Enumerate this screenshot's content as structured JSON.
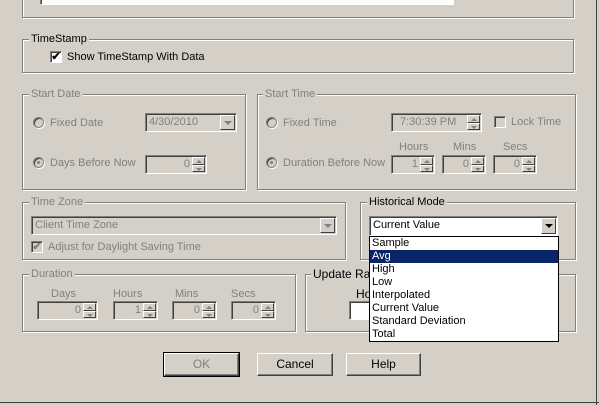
{
  "top_field": {},
  "timestamp": {
    "legend": "TimeStamp",
    "show_label": "Show TimeStamp With Data",
    "checked": true
  },
  "start_date": {
    "legend": "Start Date",
    "fixed_label": "Fixed Date",
    "fixed_value": "4/30/2010",
    "days_label": "Days Before Now",
    "days_value": "0"
  },
  "start_time": {
    "legend": "Start Time",
    "fixed_label": "Fixed Time",
    "fixed_value": "7:30:39 PM",
    "lock_label": "Lock Time",
    "duration_label": "Duration Before Now",
    "hours_label": "Hours",
    "mins_label": "Mins",
    "secs_label": "Secs",
    "hours_value": "1",
    "mins_value": "0",
    "secs_value": "0"
  },
  "time_zone": {
    "legend": "Time Zone",
    "value": "Client Time Zone",
    "dst_label": "Adjust for Daylight Saving Time"
  },
  "historical_mode": {
    "legend": "Historical Mode",
    "value": "Current Value",
    "options": [
      "Sample",
      "Avg",
      "High",
      "Low",
      "Interpolated",
      "Current Value",
      "Standard Deviation",
      "Total"
    ],
    "highlighted": "Avg"
  },
  "duration": {
    "legend": "Duration",
    "days_label": "Days",
    "hours_label": "Hours",
    "mins_label": "Mins",
    "secs_label": "Secs",
    "days_value": "0",
    "hours_value": "1",
    "mins_value": "0",
    "secs_value": "0"
  },
  "update_rate": {
    "legend": "Update Rate",
    "hours_label_partial": "Ho"
  },
  "buttons": {
    "ok": "OK",
    "cancel": "Cancel",
    "help": "Help"
  },
  "colors": {
    "face": "#d4d0c8",
    "selection": "#0a246a",
    "disabled_text": "#808080"
  }
}
